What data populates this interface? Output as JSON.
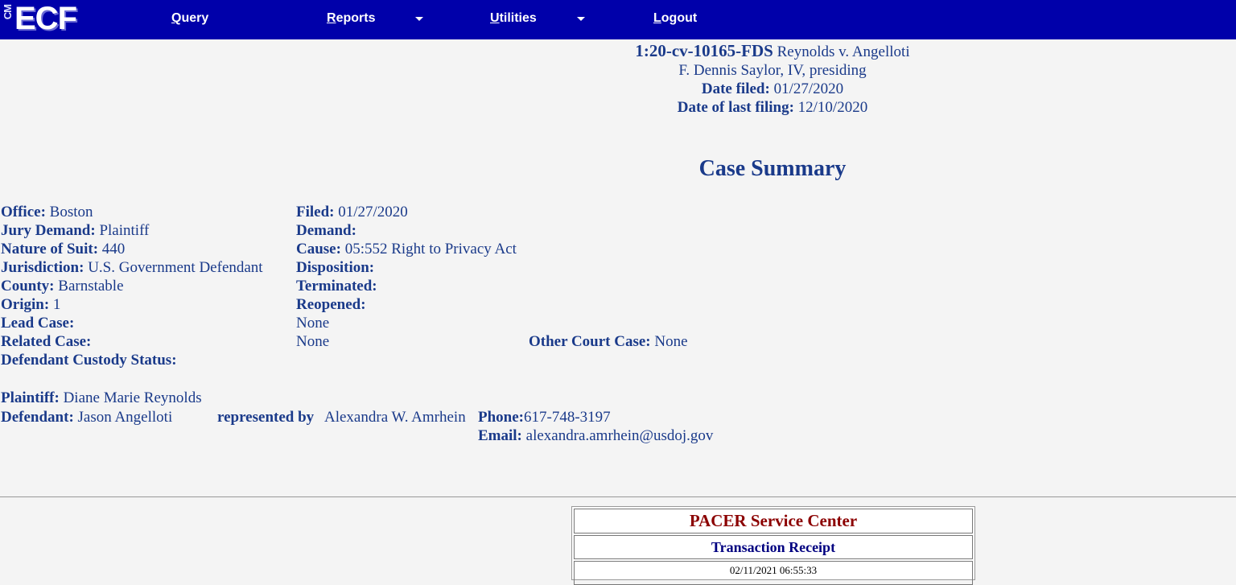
{
  "header": {
    "logo_cm": "CM",
    "logo_ecf": "ECF",
    "nav": {
      "query_first": "Q",
      "query_rest": "uery",
      "reports_first": "R",
      "reports_rest": "eports",
      "utilities_first": "U",
      "utilities_rest": "tilities",
      "logout_first": "L",
      "logout_rest": "ogout"
    }
  },
  "case": {
    "number": "1:20-cv-10165-FDS",
    "title": "Reynolds v. Angelloti",
    "judge": "F. Dennis Saylor, IV, presiding",
    "date_filed_label": "Date filed:",
    "date_filed": "01/27/2020",
    "last_filing_label": "Date of last filing:",
    "last_filing": "12/10/2020"
  },
  "summary": {
    "heading": "Case Summary",
    "left": [
      {
        "label": "Office:",
        "value": "Boston"
      },
      {
        "label": "Jury Demand:",
        "value": "Plaintiff"
      },
      {
        "label": "Nature of Suit:",
        "value": "440"
      },
      {
        "label": "Jurisdiction:",
        "value": "U.S. Government Defendant"
      },
      {
        "label": "County:",
        "value": "Barnstable"
      },
      {
        "label": "Origin:",
        "value": "1"
      },
      {
        "label": "Lead Case:",
        "value": ""
      },
      {
        "label": "Related Case:",
        "value": ""
      },
      {
        "label": "Defendant Custody Status:",
        "value": ""
      }
    ],
    "right": [
      {
        "label": "Filed:",
        "value": "01/27/2020"
      },
      {
        "label": "Demand:",
        "value": ""
      },
      {
        "label": "Cause:",
        "value": "05:552 Right to Privacy Act"
      },
      {
        "label": "Disposition:",
        "value": ""
      },
      {
        "label": "Terminated:",
        "value": ""
      },
      {
        "label": "Reopened:",
        "value": ""
      },
      {
        "label": "",
        "value": "None"
      },
      {
        "label": "",
        "value": "None"
      }
    ],
    "other_court_label": "Other Court Case:",
    "other_court_value": "None"
  },
  "parties": {
    "plaintiff_label": "Plaintiff:",
    "plaintiff": "Diane Marie Reynolds",
    "defendant_label": "Defendant:",
    "defendant": "Jason Angelloti",
    "represented_by_label": "represented by",
    "attorney": "Alexandra W. Amrhein",
    "phone_label": "Phone:",
    "phone": "617-748-3197",
    "email_label": "Email:",
    "email": "alexandra.amrhein@usdoj.gov"
  },
  "receipt": {
    "title": "PACER Service Center",
    "subtitle": "Transaction Receipt",
    "timestamp": "02/11/2021 06:55:33"
  },
  "colors": {
    "topbar": "#0000aa",
    "text": "#1a3a8a",
    "pacer_title": "#8b0000",
    "receipt_subtitle": "#000080"
  }
}
